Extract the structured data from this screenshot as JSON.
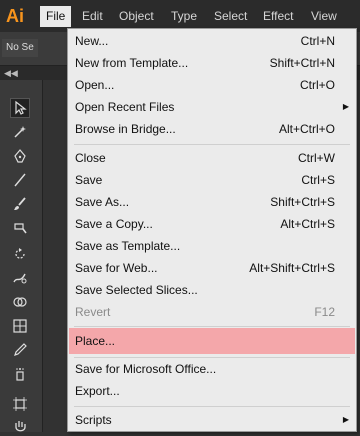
{
  "app": {
    "logo_text": "Ai",
    "logo_color": "#f7941d"
  },
  "menubar": {
    "items": [
      "File",
      "Edit",
      "Object",
      "Type",
      "Select",
      "Effect",
      "View"
    ]
  },
  "controlbar": {
    "selection_label": "No Se"
  },
  "file_menu": {
    "highlight_color": "#f4a7aa",
    "items": [
      {
        "label": "New...",
        "shortcut": "Ctrl+N"
      },
      {
        "label": "New from Template...",
        "shortcut": "Shift+Ctrl+N"
      },
      {
        "label": "Open...",
        "shortcut": "Ctrl+O"
      },
      {
        "label": "Open Recent Files",
        "shortcut": "",
        "submenu": true
      },
      {
        "label": "Browse in Bridge...",
        "shortcut": "Alt+Ctrl+O"
      },
      {
        "label": "Close",
        "shortcut": "Ctrl+W"
      },
      {
        "label": "Save",
        "shortcut": "Ctrl+S"
      },
      {
        "label": "Save As...",
        "shortcut": "Shift+Ctrl+S"
      },
      {
        "label": "Save a Copy...",
        "shortcut": "Alt+Ctrl+S"
      },
      {
        "label": "Save as Template...",
        "shortcut": ""
      },
      {
        "label": "Save for Web...",
        "shortcut": "Alt+Shift+Ctrl+S"
      },
      {
        "label": "Save Selected Slices...",
        "shortcut": ""
      },
      {
        "label": "Revert",
        "shortcut": "F12",
        "disabled": true
      },
      {
        "label": "Place...",
        "shortcut": "",
        "highlighted": true
      },
      {
        "label": "Save for Microsoft Office...",
        "shortcut": ""
      },
      {
        "label": "Export...",
        "shortcut": ""
      },
      {
        "label": "Scripts",
        "shortcut": "",
        "submenu": true
      }
    ]
  },
  "tools": [
    "selection-tool",
    "magic-wand-tool",
    "pen-tool",
    "line-tool",
    "paintbrush-tool",
    "blob-brush-tool",
    "rotate-tool",
    "warp-tool",
    "shape-builder-tool",
    "mesh-tool",
    "eyedropper-tool",
    "symbol-sprayer-tool",
    "artboard-tool",
    "hand-tool"
  ]
}
